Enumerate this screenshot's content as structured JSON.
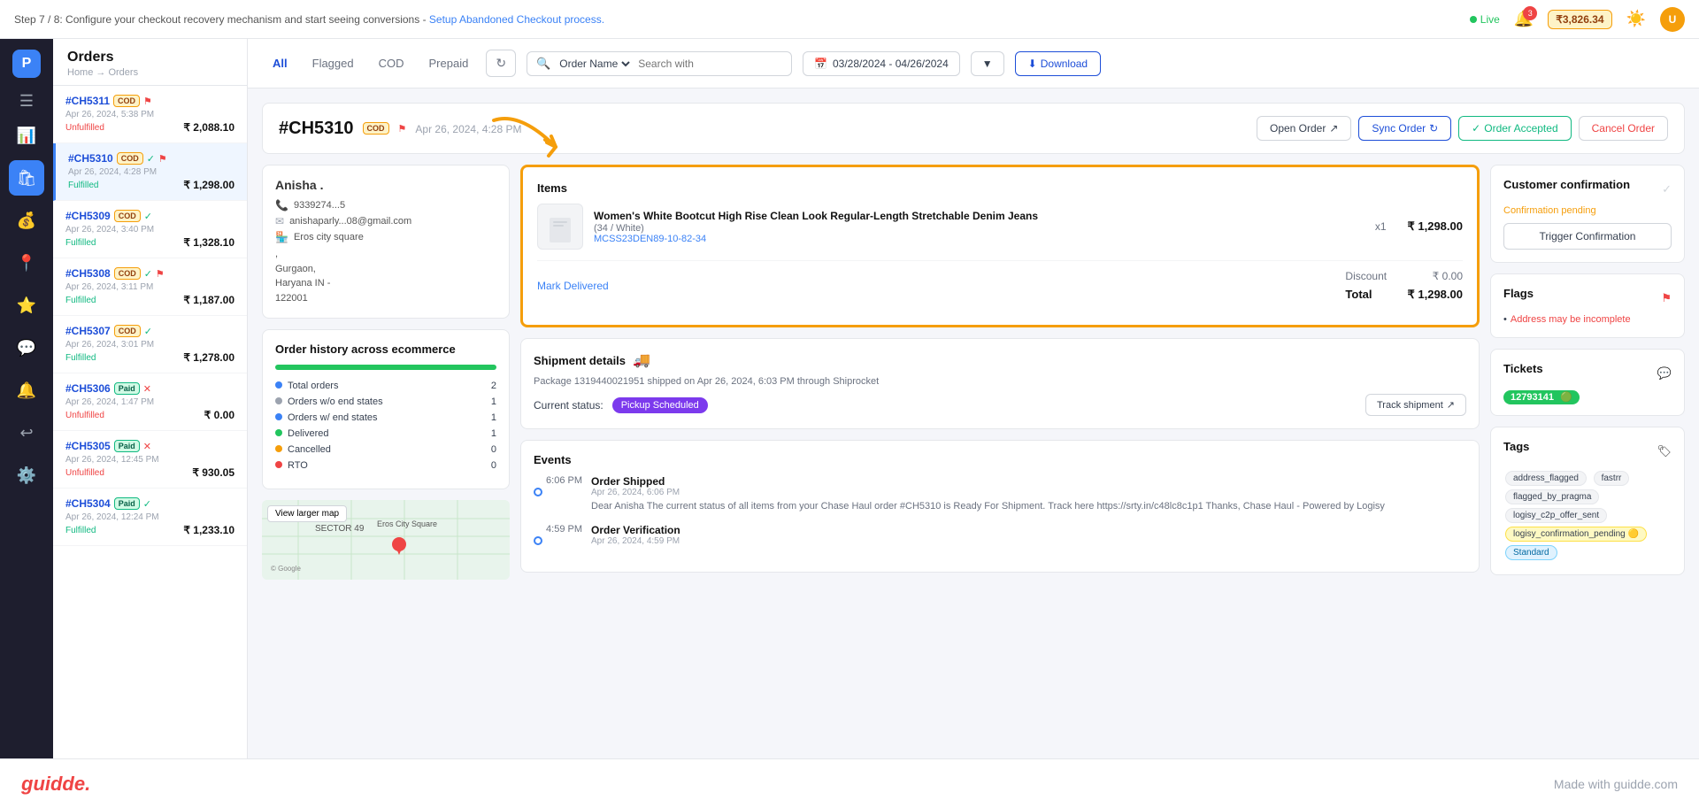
{
  "top_banner": {
    "message": "Step 7 / 8: Configure your checkout recovery mechanism and start seeing conversions - ",
    "link_text": "Setup Abandoned Checkout process.",
    "live_label": "Live",
    "notification_count": "3",
    "wallet_amount": "₹3,826.34"
  },
  "tabs": {
    "all": "All",
    "flagged": "Flagged",
    "cod": "COD",
    "prepaid": "Prepaid"
  },
  "search": {
    "placeholder": "Search with",
    "order_name_label": "Order Name",
    "date_range": "03/28/2024 - 04/26/2024"
  },
  "toolbar": {
    "download_label": "Download",
    "filter_label": "Filter"
  },
  "orders_sidebar": {
    "title": "Orders",
    "breadcrumb": "Home → Orders",
    "orders": [
      {
        "id": "#CH5311",
        "type": "COD",
        "date": "Apr 26, 2024, 5:38 PM",
        "amount": "₹ 2,088.10",
        "status": "Unfulfilled",
        "flagged": true,
        "check": false
      },
      {
        "id": "#CH5310",
        "type": "COD",
        "date": "Apr 26, 2024, 4:28 PM",
        "amount": "₹ 1,298.00",
        "status": "Fulfilled",
        "flagged": true,
        "check": true
      },
      {
        "id": "#CH5309",
        "type": "COD",
        "date": "Apr 26, 2024, 3:40 PM",
        "amount": "₹ 1,328.10",
        "status": "Fulfilled",
        "flagged": false,
        "check": true
      },
      {
        "id": "#CH5308",
        "type": "COD",
        "date": "Apr 26, 2024, 3:11 PM",
        "amount": "₹ 1,187.00",
        "status": "Fulfilled",
        "flagged": true,
        "check": true
      },
      {
        "id": "#CH5307",
        "type": "COD",
        "date": "Apr 26, 2024, 3:01 PM",
        "amount": "₹ 1,278.00",
        "status": "Fulfilled",
        "flagged": false,
        "check": true
      },
      {
        "id": "#CH5306",
        "type": "Paid",
        "date": "Apr 26, 2024, 1:47 PM",
        "amount": "₹ 0.00",
        "status": "Unfulfilled",
        "flagged": false,
        "check": false
      },
      {
        "id": "#CH5305",
        "type": "Paid",
        "date": "Apr 26, 2024, 12:45 PM",
        "amount": "₹ 930.05",
        "status": "Unfulfilled",
        "flagged": false,
        "check": false
      },
      {
        "id": "#CH5304",
        "type": "Paid",
        "date": "Apr 26, 2024, 12:24 PM",
        "amount": "₹ 1,233.10",
        "status": "Fulfilled",
        "flagged": false,
        "check": true
      }
    ]
  },
  "order_detail": {
    "id": "#CH5310",
    "type": "COD",
    "date": "Apr 26, 2024, 4:28 PM",
    "open_order_label": "Open Order",
    "sync_order_label": "Sync Order",
    "order_accepted_label": "Order Accepted",
    "cancel_order_label": "Cancel Order",
    "customer": {
      "name": "Anisha .",
      "phone": "9339274...5",
      "email": "anishaparly...08@gmail.com",
      "store": "Eros city square",
      "address": "Gurgaon,\nHaryana IN -\n122001"
    },
    "order_history": {
      "title": "Order history across ecommerce",
      "rows": [
        {
          "label": "Total orders",
          "value": "2",
          "dot": "blue"
        },
        {
          "label": "Orders w/o end states",
          "value": "1",
          "dot": "gray"
        },
        {
          "label": "Orders w/ end states",
          "value": "1",
          "dot": "blue"
        },
        {
          "label": "Delivered",
          "value": "1",
          "dot": "green"
        },
        {
          "label": "Cancelled",
          "value": "0",
          "dot": "yellow"
        },
        {
          "label": "RTO",
          "value": "0",
          "dot": "red"
        }
      ]
    },
    "items": {
      "title": "Items",
      "product_name": "Women's White Bootcut High Rise Clean Look Regular-Length Stretchable Denim Jeans",
      "variant": "(34 / White)",
      "sku": "MCSS23DEN89-10-82-34",
      "qty": "x1",
      "price": "₹ 1,298.00",
      "mark_delivered": "Mark Delivered",
      "discount_label": "Discount",
      "discount_value": "₹ 0.00",
      "total_label": "Total",
      "total_value": "₹ 1,298.00"
    },
    "shipment": {
      "title": "Shipment details",
      "info": "Package 1319440021951 shipped on Apr 26, 2024, 6:03 PM through Shiprocket",
      "current_status_label": "Current status:",
      "status": "Pickup Scheduled",
      "track_label": "Track shipment"
    },
    "events": {
      "title": "Events",
      "items": [
        {
          "time": "6:06 PM",
          "title": "Order Shipped",
          "date": "Apr 26, 2024, 6:06 PM",
          "desc": "Dear Anisha The current status of all items from your Chase Haul order #CH5310 is Ready For Shipment. Track here https://srty.in/c48lc8c1p1 Thanks, Chase Haul - Powered by Logisy"
        },
        {
          "time": "4:59 PM",
          "title": "Order Verification",
          "date": "Apr 26, 2024, 4:59 PM",
          "desc": "..."
        }
      ]
    },
    "customer_confirmation": {
      "title": "Customer confirmation",
      "status": "Confirmation pending",
      "trigger_label": "Trigger Confirmation"
    },
    "flags": {
      "title": "Flags",
      "text": "Address may be incomplete"
    },
    "tickets": {
      "title": "Tickets",
      "badge": "12793141"
    },
    "tags": {
      "title": "Tags",
      "items": [
        "address_flagged",
        "fastrr",
        "flagged_by_pragma",
        "logisy_c2p_offer_sent",
        "logisy_confirmation_pending",
        "Standard"
      ]
    }
  },
  "bottom_bar": {
    "logo": "guidde.",
    "made_with": "Made with guidde.com"
  },
  "nav_icons": [
    "chart-bar",
    "shopping-bag",
    "currency",
    "location",
    "star",
    "chat",
    "bell",
    "refresh",
    "settings"
  ]
}
